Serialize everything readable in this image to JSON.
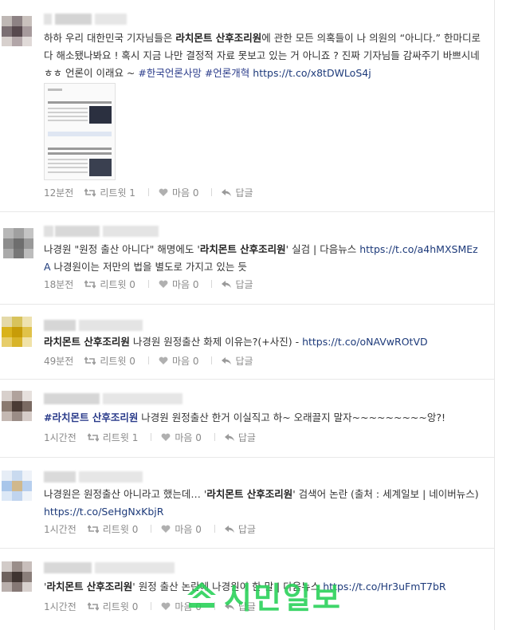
{
  "tweets": [
    {
      "text_parts": [
        {
          "t": "하하 우리 대한민국 기자님들은 "
        },
        {
          "t": "라치몬트 산후조리원",
          "b": true
        },
        {
          "t": "에 관한 모든 의혹들이 나 의원의 “아니다.” 한마디로 다 해소됐나봐요 ! 혹시 지금 나만 결정적 자료 못보고 있는 거 아니죠 ? 진짜 기자님들 감싸주기 바쁘시네 ㅎㅎ 언론이 이래요 ~ "
        },
        {
          "t": "#한국언론사망 #언론개혁",
          "tag": true
        },
        {
          "t": " "
        },
        {
          "t": "https://t.co/x8tDWLoS4j",
          "link": true
        }
      ],
      "time": "12분전",
      "retweet": "리트윗 1",
      "like": "마음 0",
      "reply": "답글"
    },
    {
      "text_parts": [
        {
          "t": "나경원 \"원정 출산 아니다\" 해명에도 '"
        },
        {
          "t": "라치몬트 산후조리원",
          "b": true
        },
        {
          "t": "' 실검 | 다음뉴스 "
        },
        {
          "t": "https://t.co/a4hMXSMEzA",
          "link": true
        },
        {
          "t": " 나경원이는 저만의 법을 별도로 가지고 있는 듯"
        }
      ],
      "time": "18분전",
      "retweet": "리트윗 0",
      "like": "마음 0",
      "reply": "답글"
    },
    {
      "text_parts": [
        {
          "t": "라치몬트 산후조리원",
          "b": true
        },
        {
          "t": " 나경원 원정출산 화제 이유는?(+사진) - "
        },
        {
          "t": "https://t.co/oNAVwROtVD",
          "link": true
        }
      ],
      "time": "49분전",
      "retweet": "리트윗 0",
      "like": "마음 0",
      "reply": "답글"
    },
    {
      "text_parts": [
        {
          "t": "#라치몬트 산후조리원",
          "hl": true
        },
        {
          "t": " 나경원 원정출산 한거 이실직고 하~ 오래끌지 말자~~~~~~~~~앙?!"
        }
      ],
      "time": "1시간전",
      "retweet": "리트윗 1",
      "like": "마음 0",
      "reply": "답글"
    },
    {
      "text_parts": [
        {
          "t": "나경원은 원정출산 아니라고 했는데… '"
        },
        {
          "t": "라치몬트 산후조리원",
          "b": true
        },
        {
          "t": "' 검색어 논란 (출처 : 세계일보 | 네이버뉴스) "
        },
        {
          "t": "https://t.co/SeHgNxKbjR",
          "link": true
        }
      ],
      "time": "1시간전",
      "retweet": "리트윗 0",
      "like": "마음 0",
      "reply": "답글"
    },
    {
      "text_parts": [
        {
          "t": "'"
        },
        {
          "t": "라치몬트 산후조리원",
          "b": true
        },
        {
          "t": "' 원정 출산 논란에 나경원이 한 말 | 다음뉴스 "
        },
        {
          "t": "https://t.co/Hr3uFmT7bR",
          "link": true
        }
      ],
      "time": "1시간전",
      "retweet": "리트윗 0",
      "like": "마음 0",
      "reply": "답글"
    }
  ],
  "watermark": "시민일보",
  "colors": {
    "link": "#1d3a7a",
    "hashtag": "#2a3b8a",
    "muted": "#8a8a8a",
    "watermark": "#2bd25a"
  }
}
